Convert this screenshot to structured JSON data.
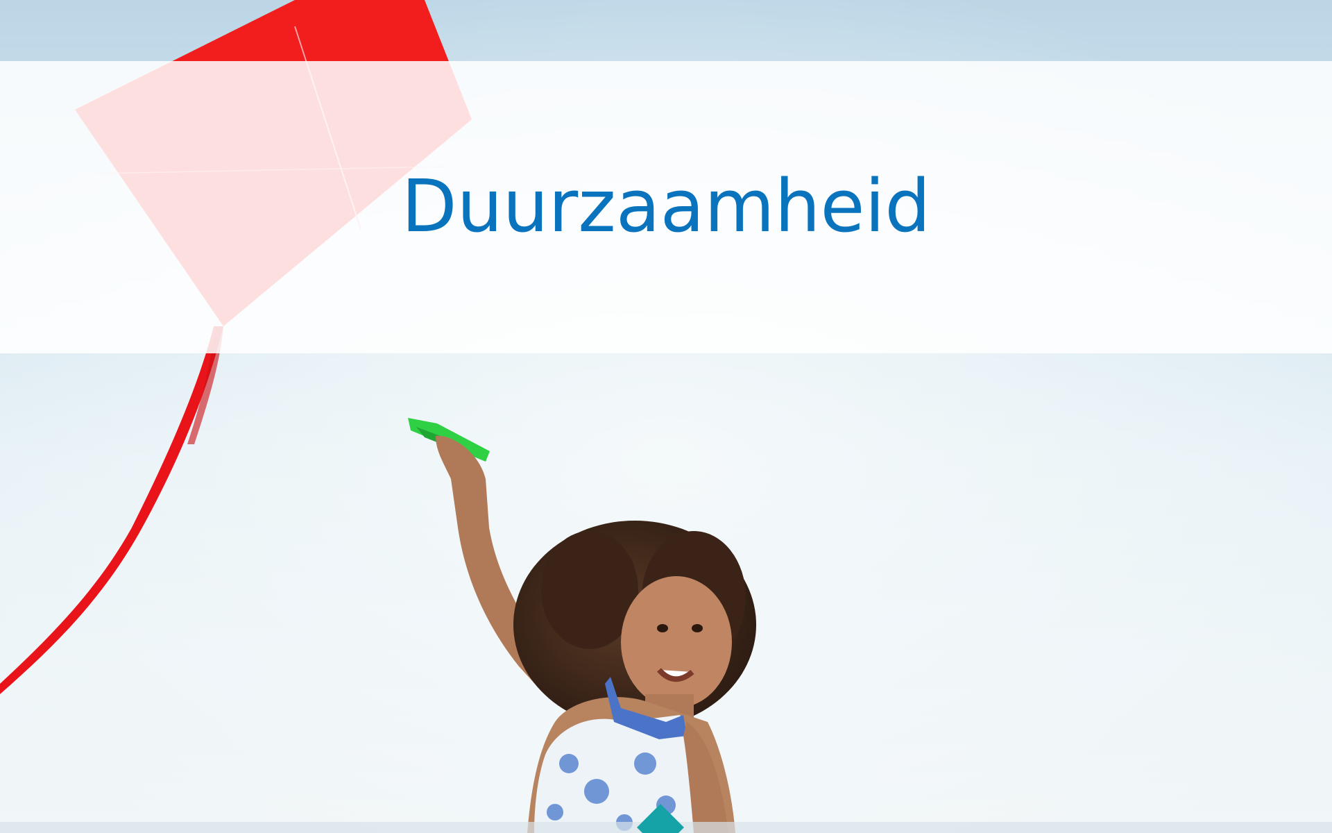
{
  "slide": {
    "title": "Duurzaamheid",
    "title_color": "#0a73bd",
    "band_color": "#ffffff",
    "badge_color": "#16a3a8"
  }
}
